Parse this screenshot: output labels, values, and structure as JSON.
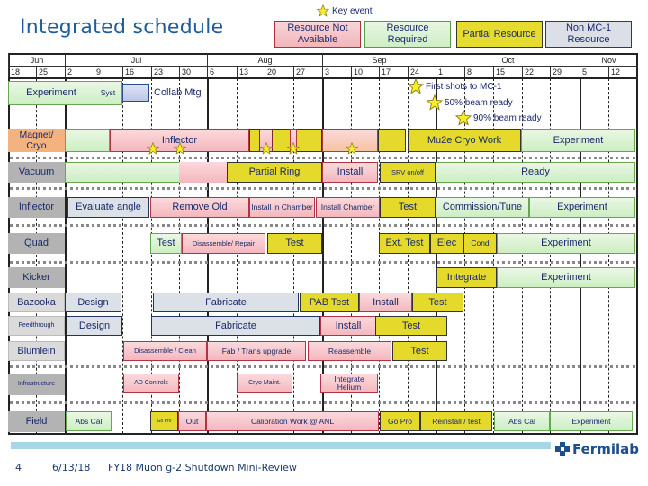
{
  "title": "Integrated schedule",
  "legend": {
    "key_event": "Key event",
    "items": [
      {
        "label": "Resource Not Available",
        "color": "#f2b6bb"
      },
      {
        "label": "Resource Required",
        "color": "#cfeec6"
      },
      {
        "label": "Partial Resource",
        "color": "#e6dc2f"
      },
      {
        "label": "Non MC-1 Resource",
        "color": "#dcdfe6"
      }
    ]
  },
  "timeline": {
    "months": [
      "Jun",
      "Jul",
      "Aug",
      "Sep",
      "Oct",
      "Nov"
    ],
    "weeks": [
      "18",
      "25",
      "2",
      "9",
      "16",
      "23",
      "30",
      "6",
      "13",
      "20",
      "27",
      "3",
      "10",
      "17",
      "24",
      "1",
      "8",
      "15",
      "22",
      "29",
      "5",
      "12"
    ]
  },
  "rows": {
    "experiment": {
      "exp": "Experiment",
      "syst": "Syst",
      "collab": "Collab Mtg"
    },
    "milestones": [
      "First shots to MC-1",
      "50% beam ready",
      "90% beam ready"
    ],
    "magnet": {
      "label": "Magnet/ Cryo",
      "inflector": "Inflector",
      "mu2e": "Mu2e Cryo Work",
      "experiment": "Experiment"
    },
    "vacuum": {
      "label": "Vacuum",
      "partial_ring": "Partial Ring",
      "install": "Install",
      "srv": "SRV on/off",
      "ready": "Ready"
    },
    "inflector": {
      "label": "Inflector",
      "evaluate": "Evaluate angle",
      "remove": "Remove Old",
      "install_in": "Install in Chamber",
      "install_ch": "Install Chamber",
      "test": "Test",
      "commission": "Commission/Tune",
      "experiment": "Experiment"
    },
    "quad": {
      "label": "Quad",
      "test1": "Test",
      "disassemble": "Disassemble/ Repair",
      "test2": "Test",
      "ext_test": "Ext. Test",
      "elec": "Elec",
      "cond": "Cond",
      "experiment": "Experiment"
    },
    "kicker": {
      "label": "Kicker",
      "integrate": "Integrate",
      "experiment": "Experiment"
    },
    "bazooka": {
      "label": "Bazooka",
      "design": "Design",
      "fabricate": "Fabricate",
      "pab": "PAB Test",
      "install": "Install",
      "test": "Test"
    },
    "feedthrough": {
      "label": "Feedthrough",
      "design": "Design",
      "fabricate": "Fabricate",
      "install": "Install",
      "test": "Test"
    },
    "blumlein": {
      "label": "Blumlein",
      "disassemble": "Disassemble / Clean",
      "fab": "Fab / Trans upgrade",
      "reassemble": "Reassemble",
      "test": "Test"
    },
    "infrastructure": {
      "label": "Infrastructure",
      "ad": "AD Controls",
      "cryo": "Cryo Maint.",
      "helium": "Integrate Helium"
    },
    "field": {
      "label": "Field",
      "abscal1": "Abs Cal",
      "gopro1": "Go Pro",
      "out": "Out",
      "calib": "Calibration Work @ ANL",
      "gopro2": "Go Pro",
      "reinstall": "Reinstall / test",
      "abscal2": "Abs Cal",
      "experiment": "Experiment"
    }
  },
  "footer": {
    "page": "4",
    "date": "6/13/18",
    "title": "FY18 Muon g-2 Shutdown Mini-Review",
    "logo": "Fermilab"
  }
}
